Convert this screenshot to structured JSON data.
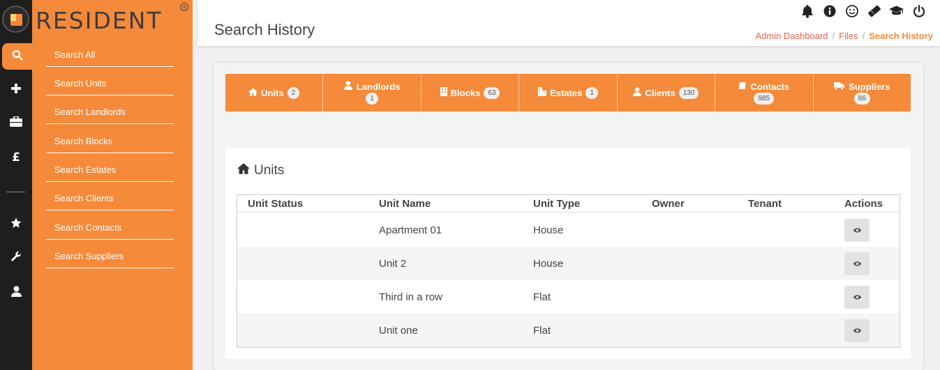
{
  "brand": {
    "name": "RESIDENT",
    "reg": "®"
  },
  "rail": {
    "items": [
      {
        "icon": "search-icon"
      },
      {
        "icon": "plus-icon"
      },
      {
        "icon": "briefcase-icon"
      },
      {
        "icon": "pound-icon",
        "glyph": "£"
      },
      {
        "icon": "star-icon"
      },
      {
        "icon": "wrench-icon"
      },
      {
        "icon": "user-icon"
      }
    ]
  },
  "sidebar": {
    "items": [
      {
        "label": "Search All"
      },
      {
        "label": "Search Units"
      },
      {
        "label": "Search Landlords"
      },
      {
        "label": "Search Blocks"
      },
      {
        "label": "Search Estates"
      },
      {
        "label": "Search Clients"
      },
      {
        "label": "Search Contacts"
      },
      {
        "label": "Search Suppliers"
      }
    ]
  },
  "header": {
    "title": "Search History",
    "icons": [
      "bell-icon",
      "info-icon",
      "smile-icon",
      "ticket-icon",
      "graduation-cap-icon",
      "power-icon"
    ],
    "breadcrumb": {
      "items": [
        "Admin Dashboard",
        "Files"
      ],
      "separator": "/",
      "current": "Search History"
    }
  },
  "tabs": [
    {
      "label": "Units",
      "count": "2",
      "icon": "home-icon"
    },
    {
      "label": "Landlords",
      "count": "1",
      "icon": "user-tie-icon"
    },
    {
      "label": "Blocks",
      "count": "63",
      "icon": "building-icon"
    },
    {
      "label": "Estates",
      "count": "1",
      "icon": "city-icon"
    },
    {
      "label": "Clients",
      "count": "130",
      "icon": "users-icon"
    },
    {
      "label": "Contacts",
      "count": "985",
      "icon": "book-icon"
    },
    {
      "label": "Suppliers",
      "count": "86",
      "icon": "truck-icon"
    }
  ],
  "panel": {
    "title": "Units",
    "columns": [
      "Unit Status",
      "Unit Name",
      "Unit Type",
      "Owner",
      "Tenant",
      "Actions"
    ],
    "rows": [
      {
        "status": "",
        "name": "Apartment 01",
        "type": "House",
        "owner": "",
        "tenant": ""
      },
      {
        "status": "",
        "name": "Unit 2",
        "type": "House",
        "owner": "",
        "tenant": ""
      },
      {
        "status": "",
        "name": "Third in a row",
        "type": "Flat",
        "owner": "",
        "tenant": ""
      },
      {
        "status": "",
        "name": "Unit one",
        "type": "Flat",
        "owner": "",
        "tenant": ""
      }
    ]
  },
  "colors": {
    "accent": "#f58a3a",
    "rail": "#1e1e1e",
    "link": "#e8604c"
  }
}
